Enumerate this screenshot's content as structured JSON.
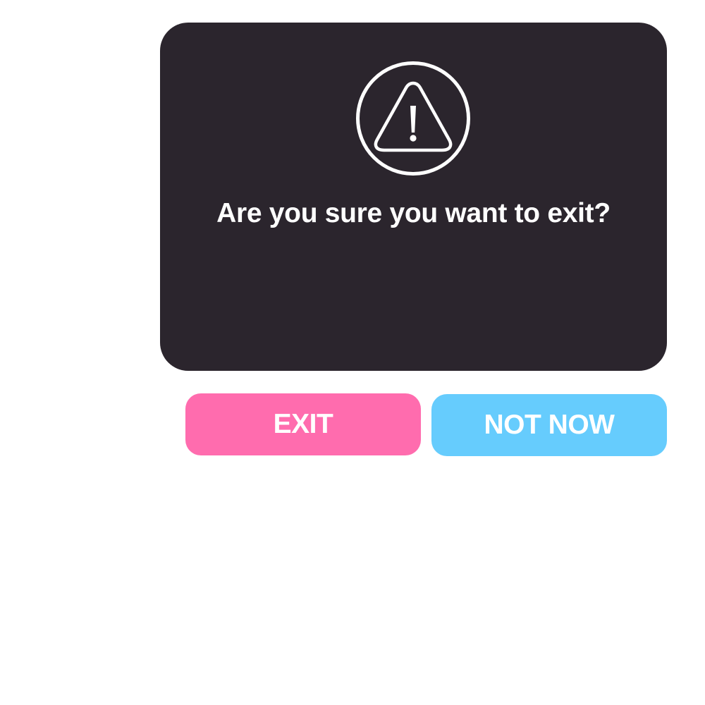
{
  "dialog": {
    "message": "Are you sure you want to exit?",
    "icon": "warning-icon",
    "background_color": "#2b252d"
  },
  "buttons": {
    "exit": {
      "label": "EXIT",
      "color": "#ff6cae"
    },
    "not_now": {
      "label": "NOT NOW",
      "color": "#66ccfd"
    }
  }
}
